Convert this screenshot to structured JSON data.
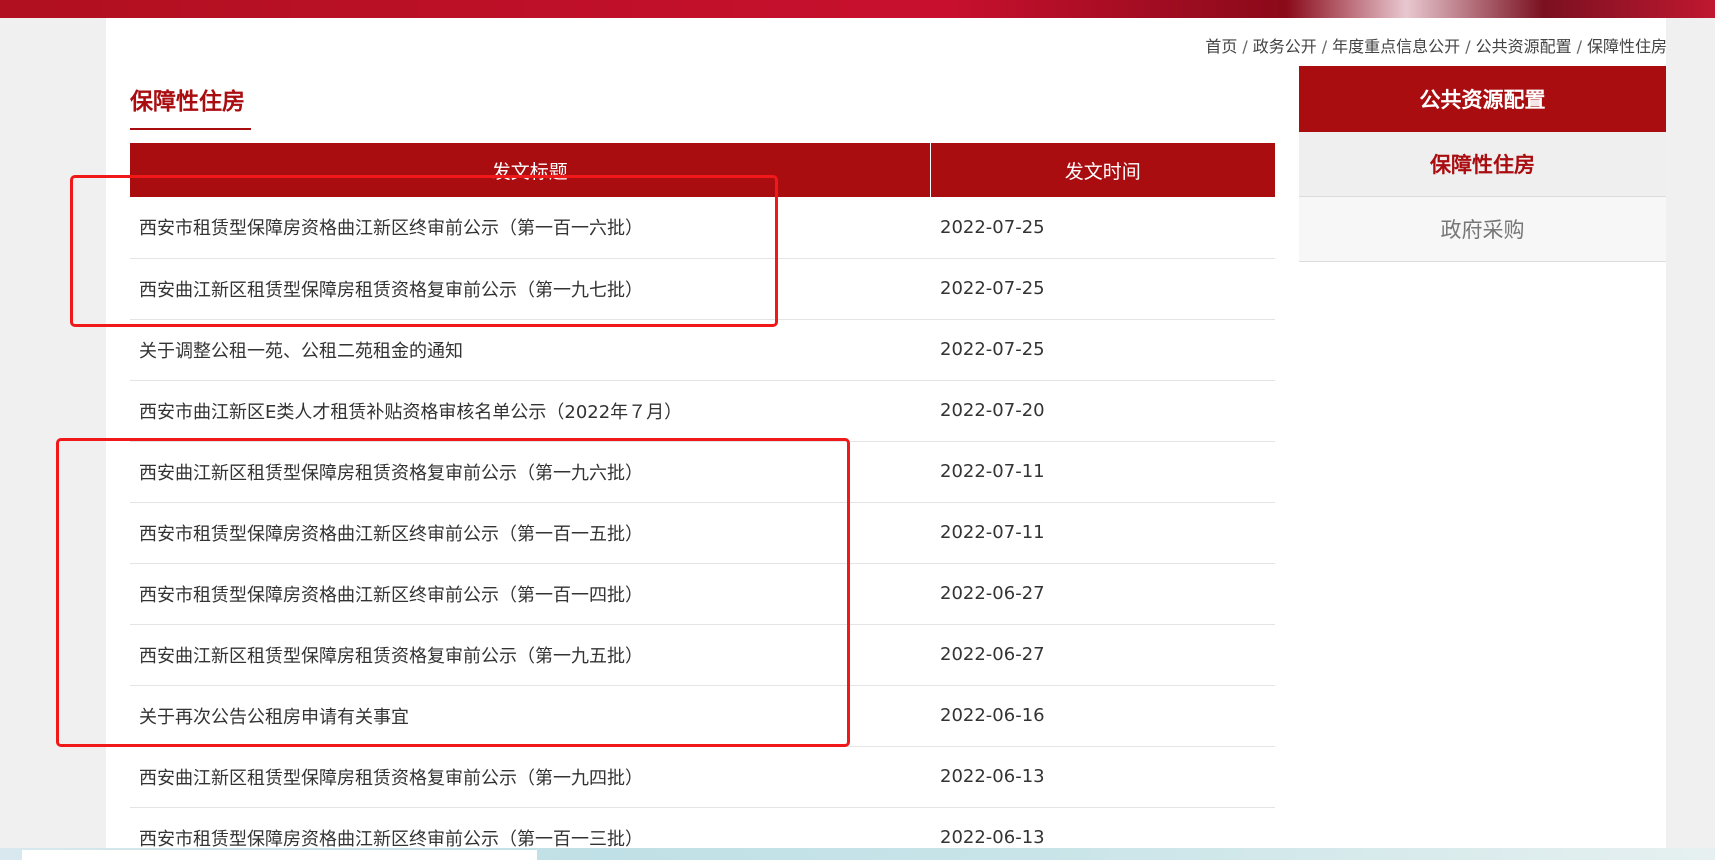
{
  "breadcrumb": {
    "items": [
      "首页",
      "政务公开",
      "年度重点信息公开",
      "公共资源配置",
      "保障性住房"
    ],
    "separator": "/"
  },
  "section_title": "保障性住房",
  "table": {
    "headers": {
      "title": "发文标题",
      "date": "发文时间"
    },
    "rows": [
      {
        "title": "西安市租赁型保障房资格曲江新区终审前公示（第一百一六批）",
        "date": "2022-07-25"
      },
      {
        "title": "西安曲江新区租赁型保障房租赁资格复审前公示（第一九七批）",
        "date": "2022-07-25"
      },
      {
        "title": "关于调整公租一苑、公租二苑租金的通知",
        "date": "2022-07-25"
      },
      {
        "title": "西安市曲江新区E类人才租赁补贴资格审核名单公示（2022年７月）",
        "date": "2022-07-20"
      },
      {
        "title": "西安曲江新区租赁型保障房租赁资格复审前公示（第一九六批）",
        "date": "2022-07-11"
      },
      {
        "title": "西安市租赁型保障房资格曲江新区终审前公示（第一百一五批）",
        "date": "2022-07-11"
      },
      {
        "title": "西安市租赁型保障房资格曲江新区终审前公示（第一百一四批）",
        "date": "2022-06-27"
      },
      {
        "title": "西安曲江新区租赁型保障房租赁资格复审前公示（第一九五批）",
        "date": "2022-06-27"
      },
      {
        "title": "关于再次公告公租房申请有关事宜",
        "date": "2022-06-16"
      },
      {
        "title": "西安曲江新区租赁型保障房租赁资格复审前公示（第一九四批）",
        "date": "2022-06-13"
      },
      {
        "title": "西安市租赁型保障房资格曲江新区终审前公示（第一百一三批）",
        "date": "2022-06-13"
      }
    ]
  },
  "sidebar": {
    "header": "公共资源配置",
    "items": [
      {
        "label": "保障性住房",
        "active": true
      },
      {
        "label": "政府采购",
        "active": false
      }
    ]
  },
  "colors": {
    "accent": "#a90d10",
    "annotation": "#f01818"
  }
}
